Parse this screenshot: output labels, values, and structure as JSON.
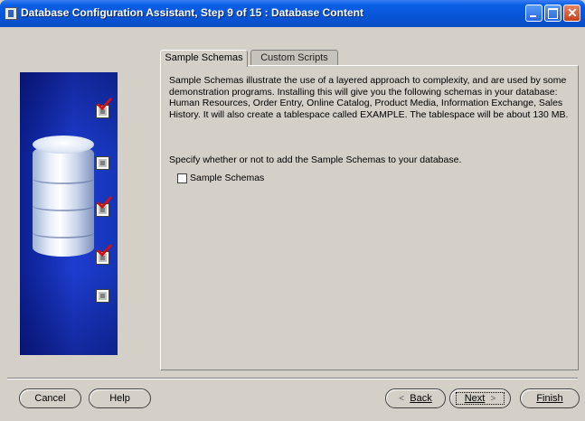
{
  "window": {
    "title": "Database Configuration Assistant, Step 9 of 15 : Database Content"
  },
  "tabs": [
    {
      "label": "Sample Schemas",
      "active": true
    },
    {
      "label": "Custom Scripts",
      "active": false
    }
  ],
  "content": {
    "description": "Sample Schemas illustrate the use of a layered approach to complexity, and are used by some demonstration programs. Installing this will give you the following schemas in your database: Human Resources, Order Entry, Online Catalog, Product Media, Information Exchange, Sales History. It will also create a tablespace called EXAMPLE. The tablespace will be about 130 MB.",
    "prompt": "Specify whether or not to add the Sample Schemas to your database.",
    "checkbox": {
      "label": "Sample Schemas",
      "checked": false
    }
  },
  "buttons": {
    "cancel": "Cancel",
    "help": "Help",
    "back": "Back",
    "next": "Next",
    "finish": "Finish"
  },
  "progress_steps": [
    {
      "completed": true
    },
    {
      "completed": false
    },
    {
      "completed": true
    },
    {
      "completed": true
    },
    {
      "completed": false
    }
  ],
  "colors": {
    "titlebar": "#0755d6",
    "graphic_background": "#1e3dd0",
    "checkmark": "#d01010",
    "dialog_background": "#d4d0c8"
  }
}
